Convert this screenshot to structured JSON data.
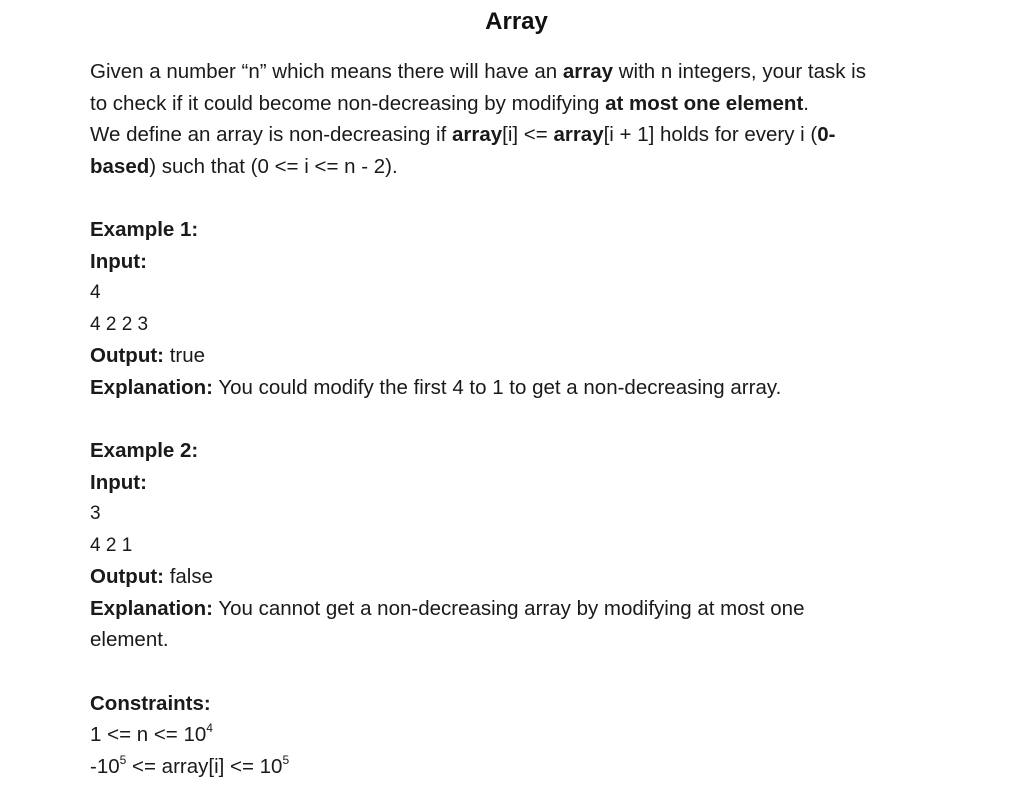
{
  "title": "Array",
  "intro": {
    "l1_a": "Given a number “n” which means there will have an ",
    "l1_b": "array",
    "l1_c": " with n integers, your task is",
    "l2_a": "to check if it could become non-decreasing by modifying ",
    "l2_b": "at most one element",
    "l2_c": ".",
    "l3_a": "We define an array is non-decreasing if ",
    "l3_b": "array",
    "l3_c": "[i] <= ",
    "l3_d": "array",
    "l3_e": "[i + 1] holds for every i (",
    "l3_f": "0-",
    "l4_a": "based",
    "l4_b": ") such that (0 <= i <= n - 2)."
  },
  "example1": {
    "heading": "Example 1:",
    "input_label": "Input:",
    "input_line1": "4",
    "input_line2": "4 2 2 3",
    "output_label": "Output:",
    "output_value": " true",
    "explanation_label": "Explanation:",
    "explanation_text": " You could modify the first 4 to 1 to get a non-decreasing array."
  },
  "example2": {
    "heading": "Example 2:",
    "input_label": "Input:",
    "input_line1": "3",
    "input_line2": "4 2 1",
    "output_label": "Output:",
    "output_value": " false",
    "explanation_label": "Explanation:",
    "explanation_text": " You cannot get a non-decreasing array by modifying at most one",
    "explanation_text2": "element."
  },
  "constraints": {
    "heading": "Constraints:",
    "c1_a": "1 <= n <= 10",
    "c1_exp": "4",
    "c2_a": "-10",
    "c2_exp": "5",
    "c2_b": " <= array[i] <= 10",
    "c2_exp2": "5"
  }
}
